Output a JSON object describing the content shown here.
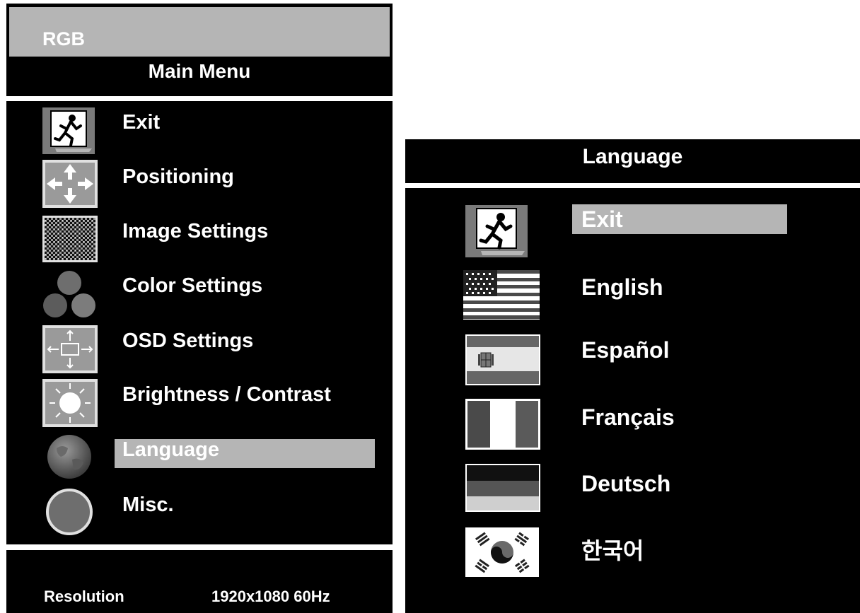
{
  "osd": {
    "source": "RGB",
    "main_menu_title": "Main Menu",
    "menu_items": [
      {
        "label": "Exit",
        "icon": "exit-icon",
        "selected": false
      },
      {
        "label": "Positioning",
        "icon": "positioning-icon",
        "selected": false
      },
      {
        "label": "Image Settings",
        "icon": "image-settings-icon",
        "selected": false
      },
      {
        "label": "Color Settings",
        "icon": "color-settings-icon",
        "selected": false
      },
      {
        "label": "OSD Settings",
        "icon": "osd-settings-icon",
        "selected": false
      },
      {
        "label": "Brightness / Contrast",
        "icon": "brightness-icon",
        "selected": false
      },
      {
        "label": "Language",
        "icon": "globe-icon",
        "selected": true
      },
      {
        "label": "Misc.",
        "icon": "misc-circle-icon",
        "selected": false
      }
    ],
    "footer": {
      "resolution_label": "Resolution",
      "resolution_value": "1920x1080 60Hz"
    }
  },
  "language_menu": {
    "title": "Language",
    "items": [
      {
        "label": "Exit",
        "icon": "exit-icon",
        "selected": true
      },
      {
        "label": "English",
        "icon": "us-flag-icon",
        "selected": false
      },
      {
        "label": "Español",
        "icon": "spain-flag-icon",
        "selected": false
      },
      {
        "label": "Français",
        "icon": "france-flag-icon",
        "selected": false
      },
      {
        "label": "Deutsch",
        "icon": "germany-flag-icon",
        "selected": false
      },
      {
        "label": "한국어",
        "icon": "korea-flag-icon",
        "selected": false
      }
    ]
  },
  "colors": {
    "panel": "#000000",
    "highlight": "#b5b5b5",
    "text": "#ffffff"
  }
}
